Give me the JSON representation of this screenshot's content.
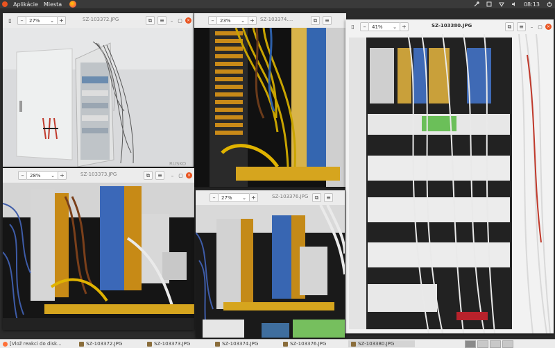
{
  "panel": {
    "apps_label": "Aplikácie",
    "places_label": "Miesta",
    "clock": "08:13"
  },
  "windows": [
    {
      "title": "SZ-103372.JPG",
      "zoom": "27%"
    },
    {
      "title": "SZ-103374....",
      "zoom": "23%"
    },
    {
      "title": "SZ-103380.JPG",
      "zoom": "41%"
    },
    {
      "title": "SZ-103373.JPG",
      "zoom": "28%"
    },
    {
      "title": "SZ-103376.JPG",
      "zoom": "27%"
    }
  ],
  "taskbar": {
    "items": [
      "[Vlož reakci do disk...",
      "SZ-103372.JPG",
      "SZ-103373.JPG",
      "SZ-103374.JPG",
      "SZ-103376.JPG",
      "SZ-103380.JPG"
    ]
  },
  "photo_watermark": "RUSKO",
  "icons": [
    "zoom-out-icon",
    "zoom-in-icon",
    "dropdown-icon",
    "copy-icon",
    "menu-icon",
    "minimize-icon",
    "maximize-icon",
    "close-icon",
    "firefox-icon",
    "ubuntu-icon",
    "volume-icon",
    "network-icon",
    "dropbox-icon",
    "power-icon"
  ]
}
